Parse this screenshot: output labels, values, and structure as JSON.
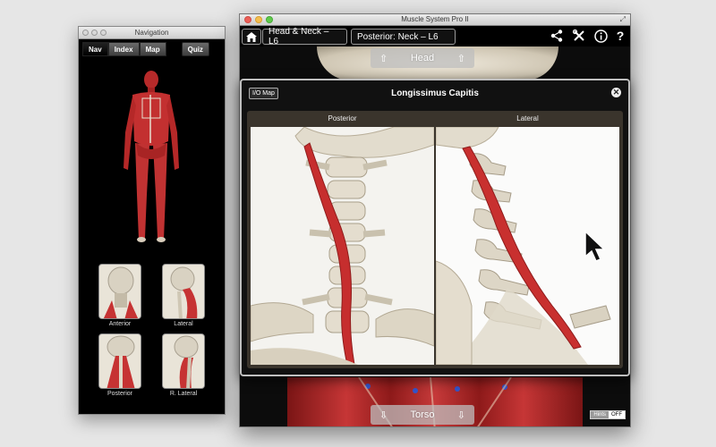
{
  "nav_window": {
    "title": "Navigation",
    "tabs": [
      "Nav",
      "Index",
      "Map"
    ],
    "quiz_label": "Quiz",
    "thumbnails": [
      {
        "label": "Anterior"
      },
      {
        "label": "Lateral"
      },
      {
        "label": "Posterior"
      },
      {
        "label": "R. Lateral"
      }
    ]
  },
  "main_window": {
    "title": "Muscle System Pro II",
    "breadcrumbs": [
      "Head & Neck – L6",
      "Posterior: Neck – L6"
    ],
    "toolbar_icons": [
      "home-icon",
      "share-icon",
      "tools-icon",
      "info-icon",
      "help-icon"
    ],
    "help_glyph": "?",
    "top_nav_label": "Head",
    "bottom_nav_label": "Torso",
    "hints": {
      "label": "Hints",
      "state": "OFF"
    }
  },
  "panel": {
    "title": "Longissimus Capitis",
    "io_map_label": "I/O Map",
    "close_glyph": "✕",
    "views": [
      {
        "label": "Posterior"
      },
      {
        "label": "Lateral"
      }
    ]
  },
  "colors": {
    "muscle_red": "#c62e2e",
    "bone": "#e8e2d4",
    "accent_blue": "#3355cc"
  }
}
